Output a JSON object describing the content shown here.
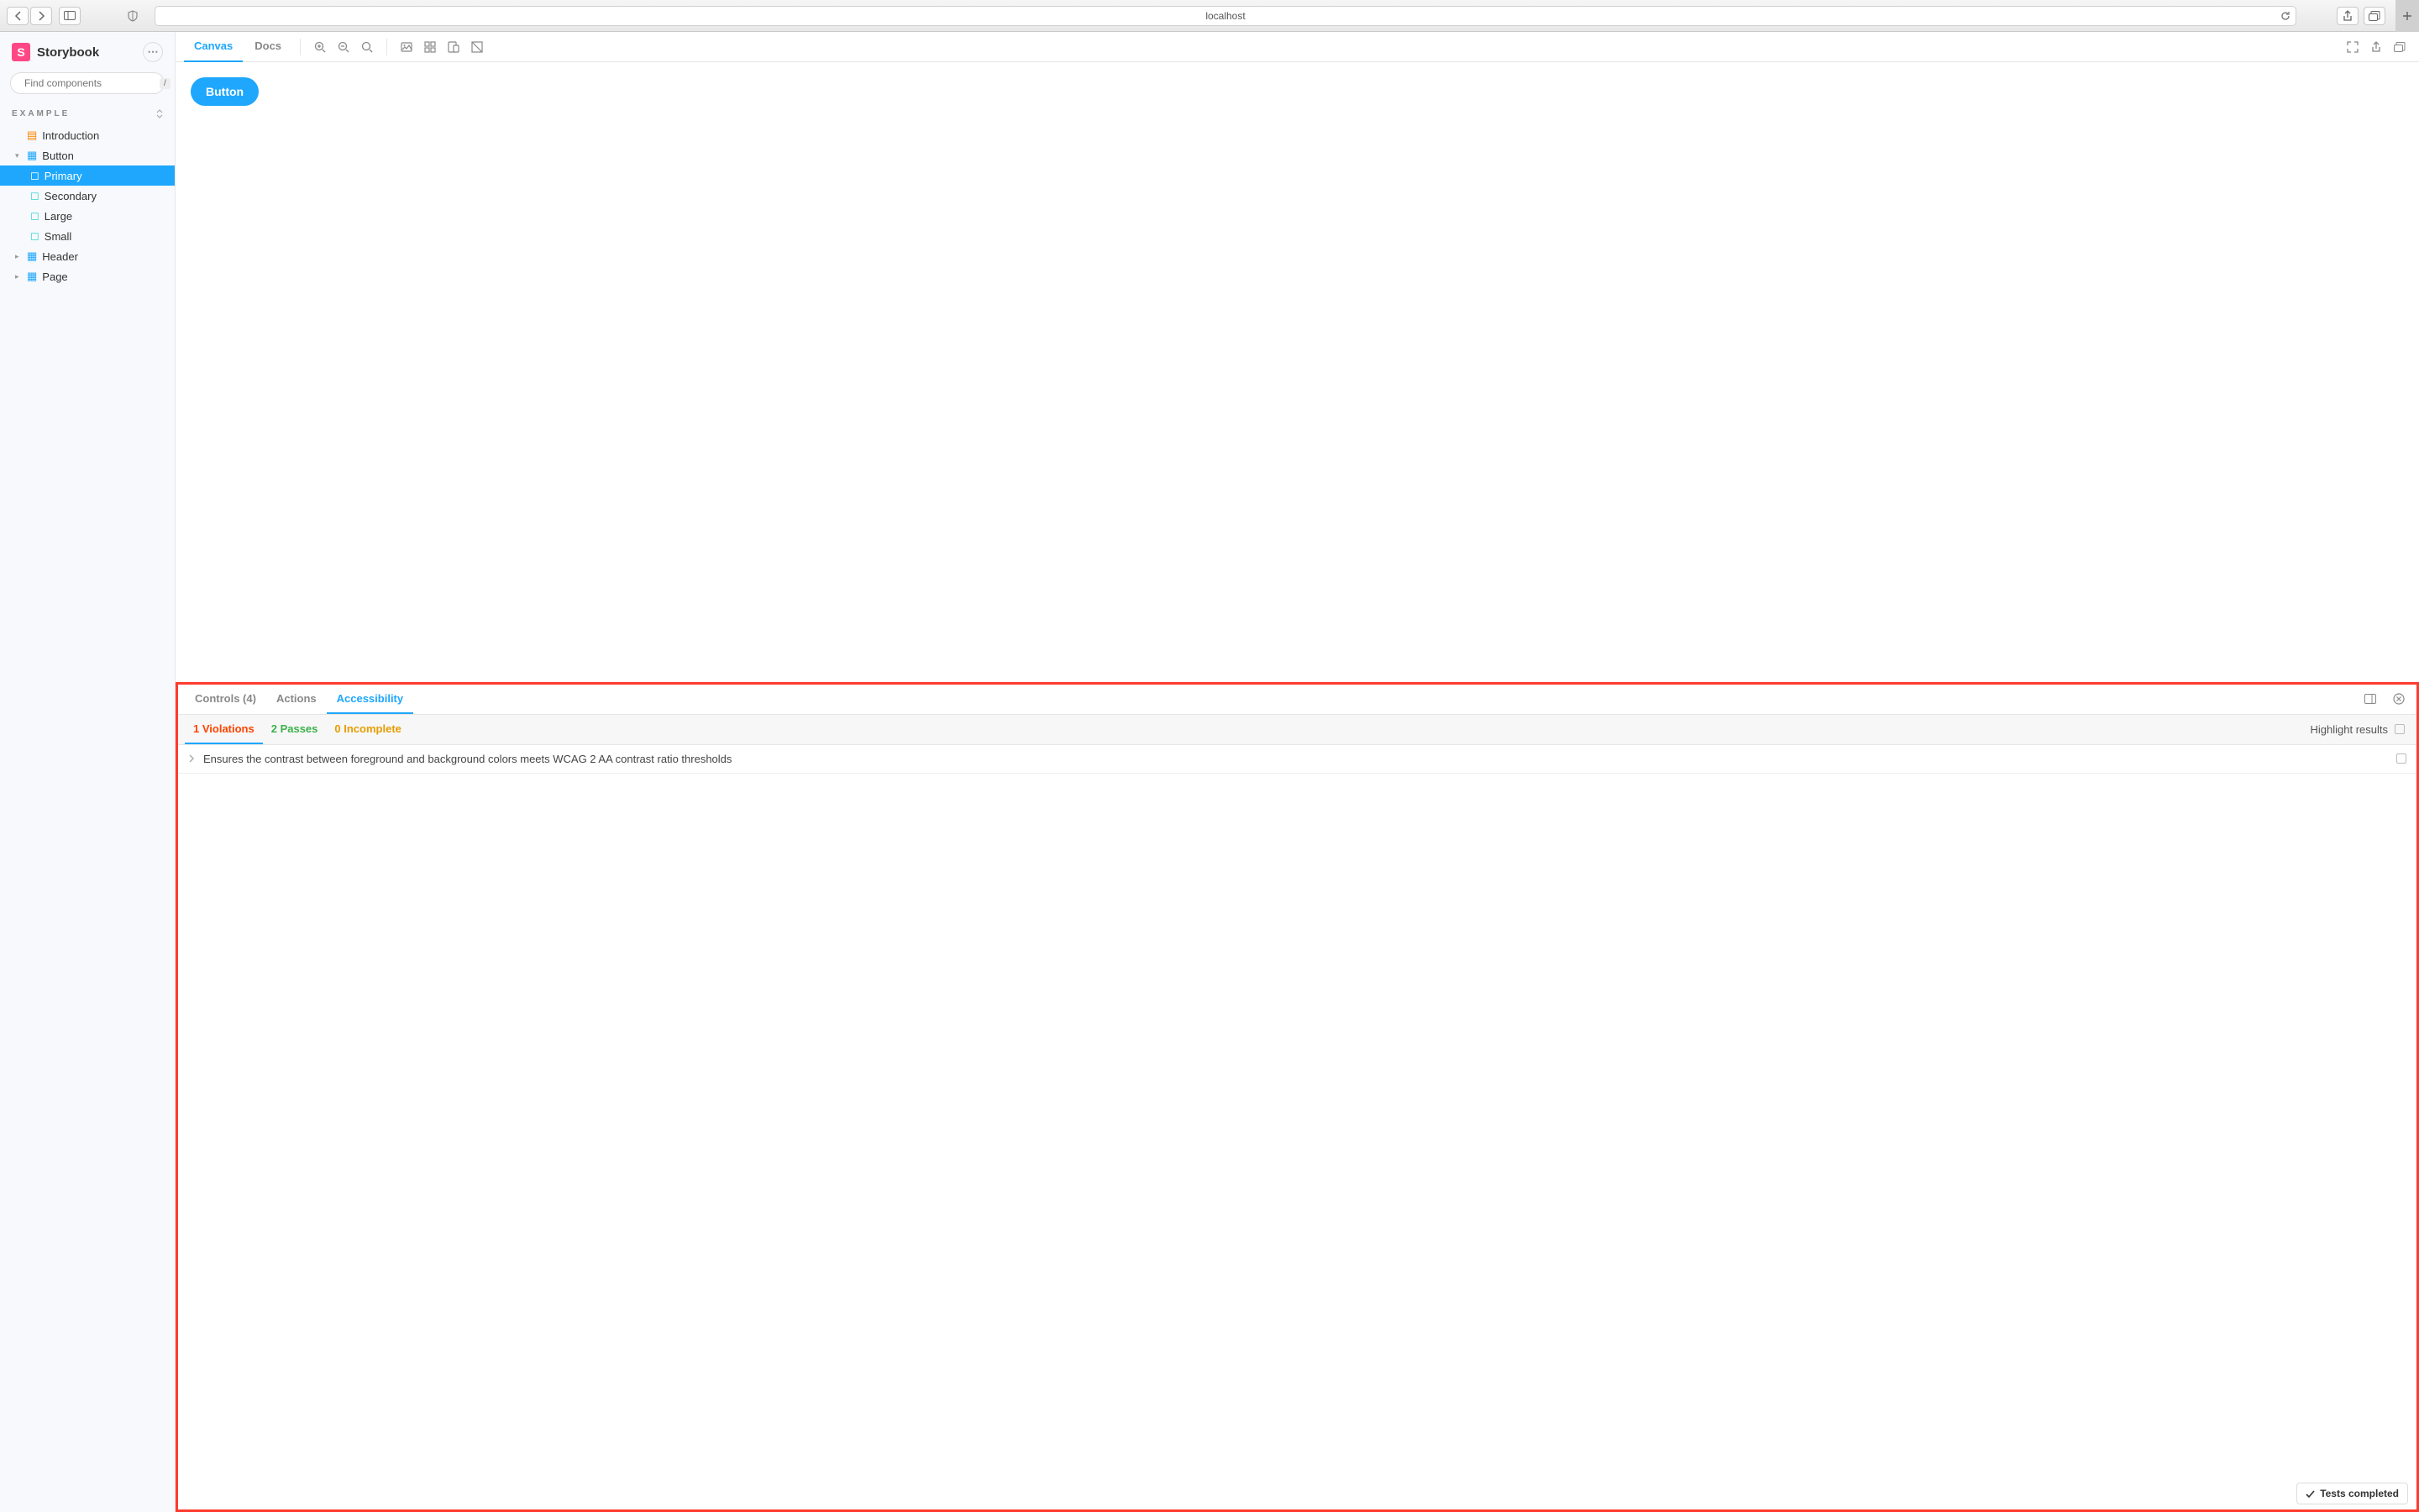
{
  "browser": {
    "url": "localhost"
  },
  "sidebar": {
    "brand": "Storybook",
    "search_placeholder": "Find components",
    "search_key": "/",
    "section": "Example",
    "items": [
      {
        "kind": "doc",
        "label": "Introduction"
      },
      {
        "kind": "component",
        "label": "Button",
        "expanded": true,
        "children": [
          {
            "label": "Primary",
            "active": true
          },
          {
            "label": "Secondary"
          },
          {
            "label": "Large"
          },
          {
            "label": "Small"
          }
        ]
      },
      {
        "kind": "component",
        "label": "Header"
      },
      {
        "kind": "component",
        "label": "Page"
      }
    ]
  },
  "toolbar": {
    "tabs": {
      "canvas": "Canvas",
      "docs": "Docs"
    }
  },
  "preview": {
    "button_label": "Button"
  },
  "addons": {
    "tabs": {
      "controls": "Controls (4)",
      "actions": "Actions",
      "a11y": "Accessibility"
    },
    "a11y": {
      "subtabs": {
        "violations": "1 Violations",
        "passes": "2 Passes",
        "incomplete": "0 Incomplete"
      },
      "highlight_label": "Highlight results",
      "rules": [
        "Ensures the contrast between foreground and background colors meets WCAG 2 AA contrast ratio thresholds"
      ],
      "status": "Tests completed"
    }
  },
  "colors": {
    "accent": "#1ea7fd",
    "violation": "#ff4400",
    "pass": "#3bb24a",
    "incomplete": "#e69d00"
  }
}
